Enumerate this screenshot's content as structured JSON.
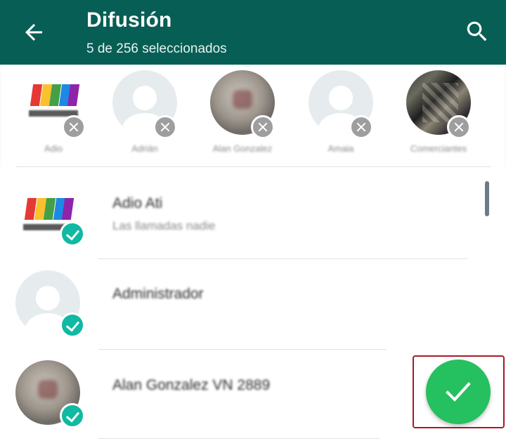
{
  "header": {
    "title": "Difusión",
    "subtitle": "5 de 256 seleccionados",
    "back_icon": "arrow-left-icon",
    "search_icon": "search-icon",
    "bar_color": "#075e54"
  },
  "selected_strip": {
    "chips": [
      {
        "label": "Adio",
        "avatar": "logo"
      },
      {
        "label": "Adrián",
        "avatar": "default"
      },
      {
        "label": "Alan Gonzalez",
        "avatar": "photo"
      },
      {
        "label": "Amaia",
        "avatar": "default"
      },
      {
        "label": "Comerciantes",
        "avatar": "photo"
      }
    ]
  },
  "contacts": [
    {
      "name": "Adio Ati",
      "status": "Las llamadas nadie",
      "selected": true
    },
    {
      "name": "Administrador",
      "status": "",
      "selected": true
    },
    {
      "name": "Alan Gonzalez VN 2889",
      "status": "",
      "selected": true
    }
  ],
  "fab": {
    "icon": "check-icon",
    "color": "#25c05f",
    "highlight_color": "#a61b2a"
  },
  "accent": {
    "check_badge": "#0fb9a2"
  }
}
